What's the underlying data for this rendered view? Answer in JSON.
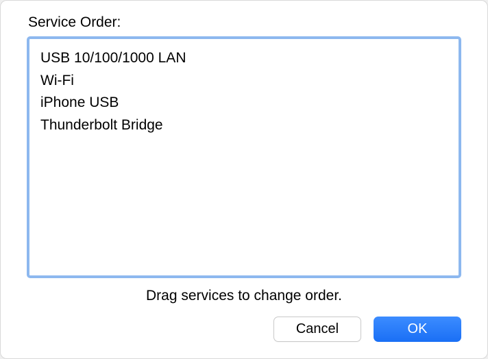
{
  "dialog": {
    "title": "Service Order:",
    "hint": "Drag services to change order."
  },
  "services": [
    "USB 10/100/1000 LAN",
    "Wi-Fi",
    "iPhone USB",
    "Thunderbolt Bridge"
  ],
  "buttons": {
    "cancel": "Cancel",
    "ok": "OK"
  }
}
